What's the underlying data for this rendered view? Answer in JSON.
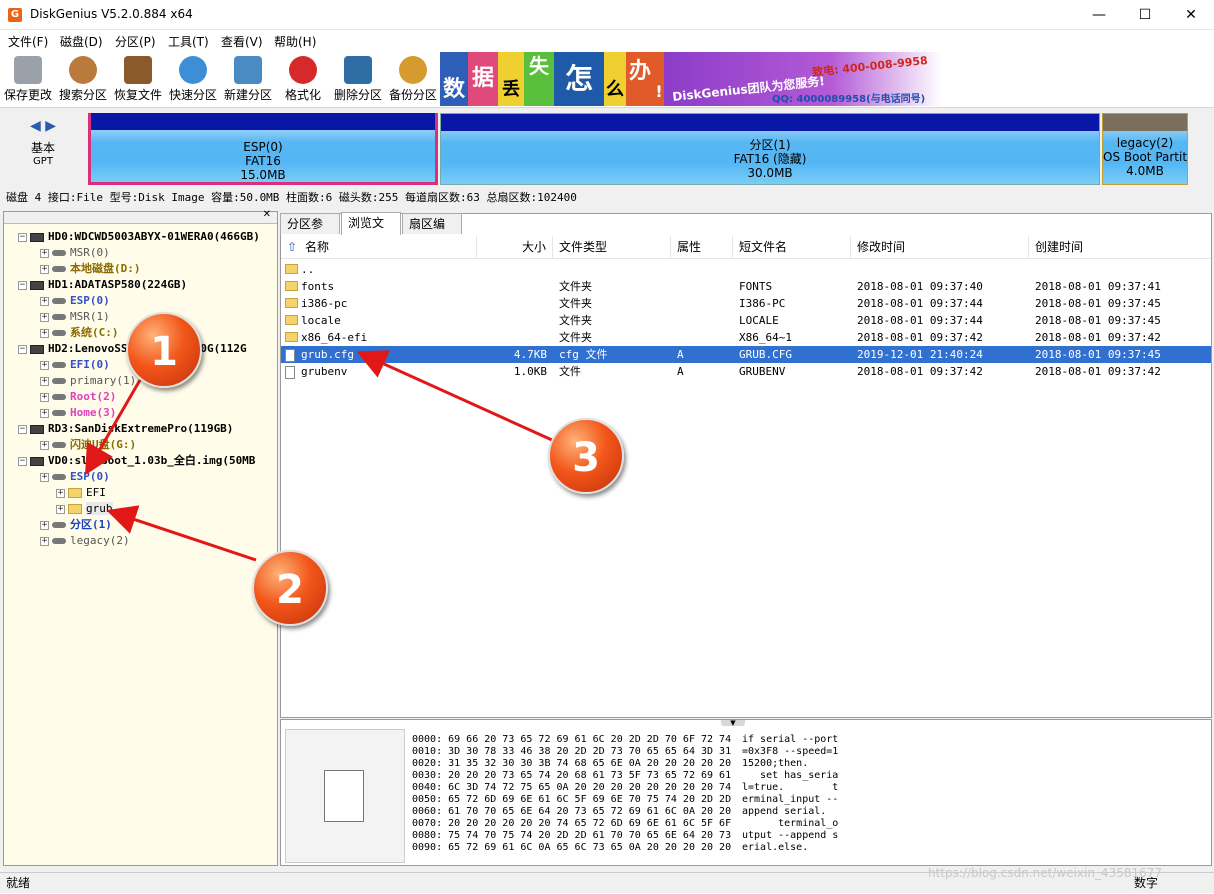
{
  "window": {
    "title": "DiskGenius V5.2.0.884 x64",
    "minimize": "—",
    "maximize": "☐",
    "close": "✕"
  },
  "menu": [
    "文件(F)",
    "磁盘(D)",
    "分区(P)",
    "工具(T)",
    "查看(V)",
    "帮助(H)"
  ],
  "toolbar": [
    {
      "label": "保存更改",
      "icon": "save-icon",
      "color": "#9aa1a8"
    },
    {
      "label": "搜索分区",
      "icon": "search-icon",
      "color": "#b97a3c"
    },
    {
      "label": "恢复文件",
      "icon": "recover-icon",
      "color": "#8a5a2a"
    },
    {
      "label": "快速分区",
      "icon": "quick-partition-icon",
      "color": "#3c8fd6"
    },
    {
      "label": "新建分区",
      "icon": "new-partition-icon",
      "color": "#4a8bc4"
    },
    {
      "label": "格式化",
      "icon": "format-icon",
      "color": "#d62a2a"
    },
    {
      "label": "删除分区",
      "icon": "delete-icon",
      "color": "#2f6ea5"
    },
    {
      "label": "备份分区",
      "icon": "backup-icon",
      "color": "#d59b2f"
    }
  ],
  "banner": {
    "chars": [
      "数",
      "据",
      "丢",
      "失",
      "怎",
      "么",
      "办",
      "!"
    ],
    "slogan": "DiskGenius团队为您服务!",
    "phone": "致电: 400-008-9958",
    "qq": "QQ: 4000089958(与电话同号)"
  },
  "disk_map": {
    "type": "基本",
    "scheme": "GPT",
    "partitions": [
      {
        "name": "ESP(0)",
        "fs": "FAT16",
        "size": "15.0MB"
      },
      {
        "name": "分区(1)",
        "fs": "FAT16 (隐藏)",
        "size": "30.0MB"
      },
      {
        "name": "legacy(2)",
        "fs": "OS Boot Partiti",
        "size": "4.0MB"
      }
    ]
  },
  "disk_info": "磁盘 4 接口:File  型号:Disk Image  容量:50.0MB  柱面数:6  磁头数:255  每道扇区数:63  总扇区数:102400",
  "tree": [
    {
      "label": "HD0:WDCWD5003ABYX-01WERA0(466GB)",
      "kind": "disk",
      "color": "#000"
    },
    {
      "label": "MSR(0)",
      "kind": "part",
      "color": "#555"
    },
    {
      "label": "本地磁盘(D:)",
      "kind": "part",
      "color": "#8a6a00"
    },
    {
      "label": "HD1:ADATASP580(224GB)",
      "kind": "disk",
      "color": "#000"
    },
    {
      "label": "ESP(0)",
      "kind": "part",
      "color": "#3050c8"
    },
    {
      "label": "MSR(1)",
      "kind": "part",
      "color": "#555"
    },
    {
      "label": "系统(C:)",
      "kind": "part",
      "color": "#8a6a00"
    },
    {
      "label": "HD2:LenovoSSDSL700PM2120G(112G",
      "kind": "disk",
      "color": "#000"
    },
    {
      "label": "EFI(0)",
      "kind": "part",
      "color": "#3050c8"
    },
    {
      "label": "primary(1)",
      "kind": "part",
      "color": "#555"
    },
    {
      "label": "Root(2)",
      "kind": "part",
      "color": "#e040c0"
    },
    {
      "label": "Home(3)",
      "kind": "part",
      "color": "#e040c0"
    },
    {
      "label": "RD3:SanDiskExtremePro(119GB)",
      "kind": "disk",
      "color": "#000"
    },
    {
      "label": "闪迪U盘(G:)",
      "kind": "part",
      "color": "#8a6a00"
    },
    {
      "label": "VD0:slimboot_1.03b_全白.img(50MB",
      "kind": "disk",
      "color": "#000"
    },
    {
      "label": "ESP(0)",
      "kind": "part",
      "color": "#3050c8"
    },
    {
      "label": "EFI",
      "kind": "folder",
      "color": "#000"
    },
    {
      "label": "grub",
      "kind": "folder",
      "color": "#000"
    },
    {
      "label": "分区(1)",
      "kind": "part",
      "color": "#1a3fbf"
    },
    {
      "label": "legacy(2)",
      "kind": "part",
      "color": "#555"
    }
  ],
  "tabs": [
    "分区参数",
    "浏览文件",
    "扇区编辑"
  ],
  "columns": [
    "名称",
    "大小",
    "文件类型",
    "属性",
    "短文件名",
    "修改时间",
    "创建时间"
  ],
  "files": [
    {
      "name": "..",
      "size": "",
      "type": "",
      "attr": "",
      "short": "",
      "mtime": "",
      "ctime": "",
      "icon": "folder"
    },
    {
      "name": "fonts",
      "size": "",
      "type": "文件夹",
      "attr": "",
      "short": "FONTS",
      "mtime": "2018-08-01 09:37:40",
      "ctime": "2018-08-01 09:37:41",
      "icon": "folder"
    },
    {
      "name": "i386-pc",
      "size": "",
      "type": "文件夹",
      "attr": "",
      "short": "I386-PC",
      "mtime": "2018-08-01 09:37:44",
      "ctime": "2018-08-01 09:37:45",
      "icon": "folder"
    },
    {
      "name": "locale",
      "size": "",
      "type": "文件夹",
      "attr": "",
      "short": "LOCALE",
      "mtime": "2018-08-01 09:37:44",
      "ctime": "2018-08-01 09:37:45",
      "icon": "folder"
    },
    {
      "name": "x86_64-efi",
      "size": "",
      "type": "文件夹",
      "attr": "",
      "short": "X86_64~1",
      "mtime": "2018-08-01 09:37:42",
      "ctime": "2018-08-01 09:37:42",
      "icon": "folder"
    },
    {
      "name": "grub.cfg",
      "size": "4.7KB",
      "type": "cfg 文件",
      "attr": "A",
      "short": "GRUB.CFG",
      "mtime": "2019-12-01 21:40:24",
      "ctime": "2018-08-01 09:37:45",
      "icon": "file"
    },
    {
      "name": "grubenv",
      "size": "1.0KB",
      "type": "文件",
      "attr": "A",
      "short": "GRUBENV",
      "mtime": "2018-08-01 09:37:42",
      "ctime": "2018-08-01 09:37:42",
      "icon": "file"
    }
  ],
  "hex": {
    "lines": [
      "0000: 69 66 20 73 65 72 69 61 6C 20 2D 2D 70 6F 72 74",
      "0010: 3D 30 78 33 46 38 20 2D 2D 73 70 65 65 64 3D 31",
      "0020: 31 35 32 30 30 3B 74 68 65 6E 0A 20 20 20 20 20",
      "0030: 20 20 20 73 65 74 20 68 61 73 5F 73 65 72 69 61",
      "0040: 6C 3D 74 72 75 65 0A 20 20 20 20 20 20 20 20 74",
      "0050: 65 72 6D 69 6E 61 6C 5F 69 6E 70 75 74 20 2D 2D",
      "0060: 61 70 70 65 6E 64 20 73 65 72 69 61 6C 0A 20 20",
      "0070: 20 20 20 20 20 20 74 65 72 6D 69 6E 61 6C 5F 6F",
      "0080: 75 74 70 75 74 20 2D 2D 61 70 70 65 6E 64 20 73",
      "0090: 65 72 69 61 6C 0A 65 6C 73 65 0A 20 20 20 20 20"
    ],
    "text": [
      "if serial --port",
      "=0x3F8 --speed=1",
      "15200;then.",
      "   set has_seria",
      "l=true.        t",
      "erminal_input --",
      "append serial.",
      "      terminal_o",
      "utput --append s",
      "erial.else."
    ]
  },
  "status": {
    "left": "就绪",
    "right": "数字"
  },
  "annotations": [
    "1",
    "2",
    "3"
  ],
  "watermark": "https://blog.csdn.net/weixin_43581677"
}
